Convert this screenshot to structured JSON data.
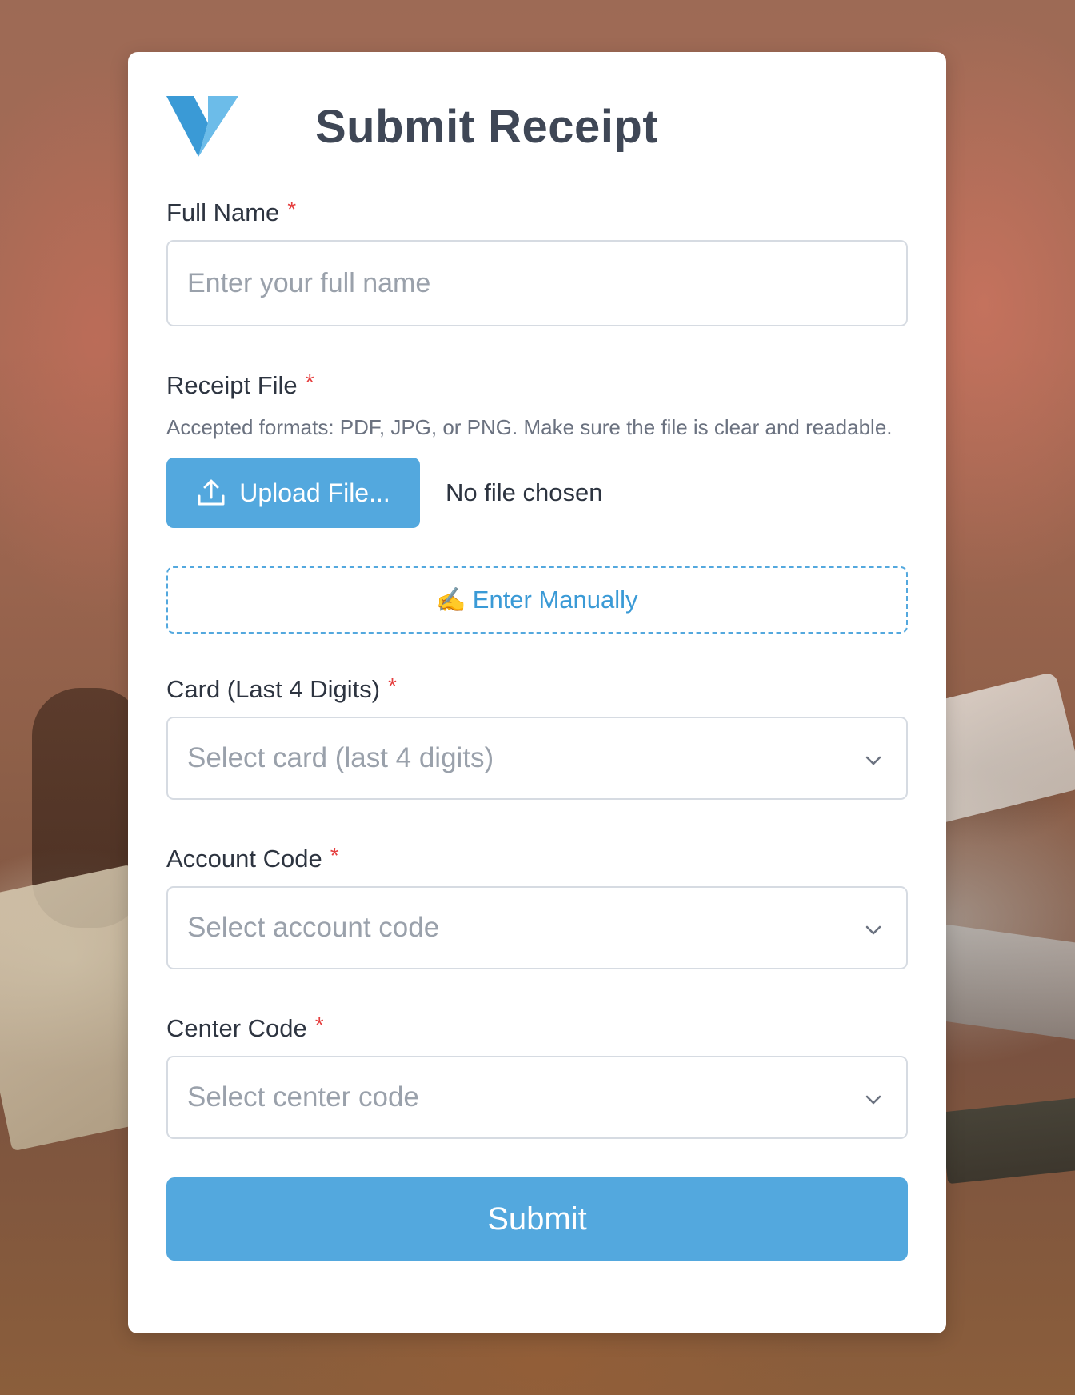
{
  "colors": {
    "accent": "#53a8de",
    "title": "#3f4756",
    "required": "#e53e3e",
    "placeholder": "#9aa1ab"
  },
  "header": {
    "title": "Submit Receipt",
    "logo_icon": "v-logo-icon"
  },
  "form": {
    "full_name": {
      "label": "Full Name",
      "required_mark": "*",
      "placeholder": "Enter your full name",
      "value": ""
    },
    "receipt_file": {
      "label": "Receipt File",
      "required_mark": "*",
      "hint": "Accepted formats: PDF, JPG, or PNG. Make sure the file is clear and readable.",
      "upload_button_label": "Upload File...",
      "upload_icon": "upload-icon",
      "status": "No file chosen"
    },
    "manual_entry": {
      "icon": "✍️",
      "label": "Enter Manually"
    },
    "card": {
      "label": "Card (Last 4 Digits)",
      "required_mark": "*",
      "placeholder": "Select card (last 4 digits)"
    },
    "account_code": {
      "label": "Account Code",
      "required_mark": "*",
      "placeholder": "Select account code"
    },
    "center_code": {
      "label": "Center Code",
      "required_mark": "*",
      "placeholder": "Select center code"
    },
    "submit_label": "Submit"
  }
}
